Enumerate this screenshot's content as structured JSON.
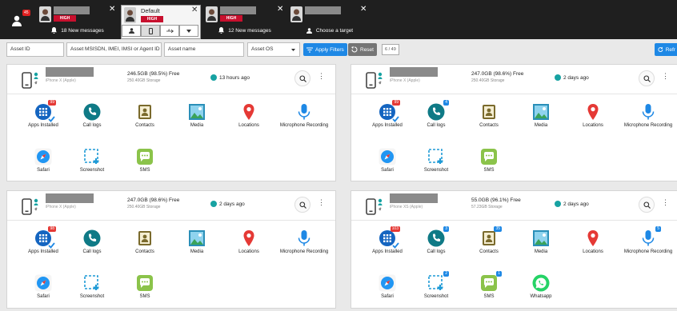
{
  "topbar": {
    "user_count": "45",
    "tabs": [
      {
        "label": "HIGH",
        "status": "18 New messages",
        "active": false
      },
      {
        "title": "Default",
        "label": "HIGH",
        "active": true
      },
      {
        "label": "HIGH",
        "status": "12 New messages",
        "active": false
      },
      {
        "status": "Choose a target",
        "active": false
      }
    ]
  },
  "filters": {
    "asset_id_placeholder": "Asset ID",
    "msisdn_placeholder": "Asset MSISDN, IMEI, IMSI or Agent ID",
    "asset_name_placeholder": "Asset name",
    "asset_os_label": "Asset OS",
    "apply_label": "Apply Filters",
    "reset_label": "Reset",
    "pager": "6 / 49",
    "refresh_label": "Refr"
  },
  "cards": [
    {
      "model": "iPhone X (Apple)",
      "storage_free": "246.5GB (98.5%) Free",
      "storage_total": "250.40GB Storage",
      "last_seen": "13 hours ago",
      "apps": [
        {
          "label": "Apps Installed",
          "icon": "apps-icon",
          "count": "99",
          "count_color": "red",
          "check": true
        },
        {
          "label": "Call logs",
          "icon": "phone-icon"
        },
        {
          "label": "Contacts",
          "icon": "contacts-icon"
        },
        {
          "label": "Media",
          "icon": "media-icon"
        },
        {
          "label": "Locations",
          "icon": "location-icon"
        },
        {
          "label": "Microphone Recording",
          "icon": "microphone-icon"
        },
        {
          "label": "Safari",
          "icon": "safari-icon"
        },
        {
          "label": "Screenshot",
          "icon": "screenshot-icon"
        },
        {
          "label": "SMS",
          "icon": "sms-icon"
        }
      ]
    },
    {
      "model": "iPhone X (Apple)",
      "storage_free": "247.0GB (98.6%) Free",
      "storage_total": "250.40GB Storage",
      "last_seen": "2 days ago",
      "apps": [
        {
          "label": "Apps Installed",
          "icon": "apps-icon",
          "count": "99",
          "count_color": "red",
          "check": true
        },
        {
          "label": "Call logs",
          "icon": "phone-icon",
          "count": "4",
          "count_color": "blue"
        },
        {
          "label": "Contacts",
          "icon": "contacts-icon"
        },
        {
          "label": "Media",
          "icon": "media-icon"
        },
        {
          "label": "Locations",
          "icon": "location-icon"
        },
        {
          "label": "Microphone Recording",
          "icon": "microphone-icon"
        },
        {
          "label": "Safari",
          "icon": "safari-icon"
        },
        {
          "label": "Screenshot",
          "icon": "screenshot-icon"
        },
        {
          "label": "SMS",
          "icon": "sms-icon"
        }
      ]
    },
    {
      "model": "iPhone X (Apple)",
      "storage_free": "247.0GB (98.6%) Free",
      "storage_total": "250.40GB Storage",
      "last_seen": "2 days ago",
      "apps": [
        {
          "label": "Apps Installed",
          "icon": "apps-icon",
          "count": "98",
          "count_color": "red",
          "check": true
        },
        {
          "label": "Call logs",
          "icon": "phone-icon"
        },
        {
          "label": "Contacts",
          "icon": "contacts-icon"
        },
        {
          "label": "Media",
          "icon": "media-icon"
        },
        {
          "label": "Locations",
          "icon": "location-icon"
        },
        {
          "label": "Microphone Recording",
          "icon": "microphone-icon"
        },
        {
          "label": "Safari",
          "icon": "safari-icon"
        },
        {
          "label": "Screenshot",
          "icon": "screenshot-icon"
        },
        {
          "label": "SMS",
          "icon": "sms-icon"
        }
      ]
    },
    {
      "model": "iPhone XS (Apple)",
      "storage_free": "55.0GB (96.1%) Free",
      "storage_total": "57.23GB Storage",
      "last_seen": "2 days ago",
      "apps": [
        {
          "label": "Apps Installed",
          "icon": "apps-icon",
          "count": "103",
          "count_color": "red",
          "check": true
        },
        {
          "label": "Call logs",
          "icon": "phone-icon",
          "count": "3",
          "count_color": "blue"
        },
        {
          "label": "Contacts",
          "icon": "contacts-icon",
          "count": "35",
          "count_color": "blue"
        },
        {
          "label": "Media",
          "icon": "media-icon"
        },
        {
          "label": "Locations",
          "icon": "location-icon"
        },
        {
          "label": "Microphone Recording",
          "icon": "microphone-icon",
          "count": "5",
          "count_color": "blue"
        },
        {
          "label": "Safari",
          "icon": "safari-icon"
        },
        {
          "label": "Screenshot",
          "icon": "screenshot-icon",
          "count": "2",
          "count_color": "blue"
        },
        {
          "label": "SMS",
          "icon": "sms-icon",
          "count": "1",
          "count_color": "blue"
        },
        {
          "label": "Whatsapp",
          "icon": "whatsapp-icon"
        }
      ]
    }
  ]
}
